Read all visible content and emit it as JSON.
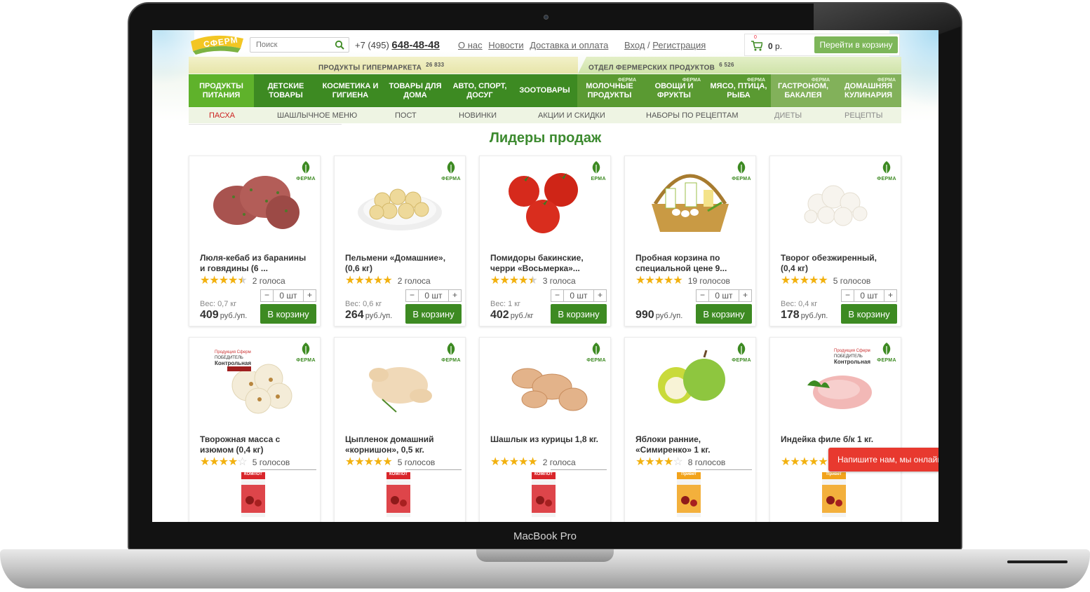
{
  "device": {
    "label": "MacBook Pro"
  },
  "header": {
    "logo_text": "СФЕРМ",
    "search_placeholder": "Поиск",
    "phone_prefix": "+7 (495)",
    "phone_number": "648-48-48",
    "links": [
      "О нас",
      "Новости",
      "Доставка и оплата"
    ],
    "login": "Вход",
    "register": "Регистрация",
    "cart_count": "0",
    "cart_sum": "0",
    "cart_currency": "р.",
    "cart_button": "Перейти в корзину"
  },
  "catalogs": {
    "left_title": "ПРОДУКТЫ ГИПЕРМАРКЕТА",
    "left_count": "26 833",
    "right_title": "ОТДЕЛ ФЕРМЕРСКИХ ПРОДУКТОВ",
    "right_count": "6 526"
  },
  "nav": [
    {
      "label": "Продукты питания",
      "farm": ""
    },
    {
      "label": "Детские товары",
      "farm": ""
    },
    {
      "label": "Косметика и гигиена",
      "farm": ""
    },
    {
      "label": "Товары для дома",
      "farm": ""
    },
    {
      "label": "Авто, спорт, досуг",
      "farm": ""
    },
    {
      "label": "Зоотовары",
      "farm": ""
    },
    {
      "label": "Молочные продукты",
      "farm": "ФЕРМА"
    },
    {
      "label": "Овощи и фрукты",
      "farm": "ФЕРМА"
    },
    {
      "label": "Мясо, птица, рыба",
      "farm": "ФЕРМА"
    },
    {
      "label": "Гастроном, бакалея",
      "farm": "ФЕРМА"
    },
    {
      "label": "Домашняя кулинария",
      "farm": "ФЕРМА"
    }
  ],
  "subnav": [
    "ПАСХА",
    "ШАШЛЫЧНОЕ МЕНЮ",
    "ПОСТ",
    "НОВИНКИ",
    "АКЦИИ И СКИДКИ",
    "НАБОРЫ ПО РЕЦЕПТАМ",
    "ДИЕТЫ",
    "РЕЦЕПТЫ"
  ],
  "section_title": "Лидеры продаж",
  "farm_badge": "ФЕРМА",
  "products_row1": [
    {
      "name": "Люля-кебаб из баранины и говядины (6 ...",
      "stars": "★★★★★",
      "votes": "2 голоса",
      "qty": "0 шт",
      "weight": "Вес: 0,7 кг",
      "price": "409",
      "unit": "руб./уп.",
      "buy": "В корзину"
    },
    {
      "name": "Пельмени «Домашние», (0,6 кг)",
      "stars": "★★★★★",
      "votes": "2 голоса",
      "qty": "0 шт",
      "weight": "Вес: 0,6 кг",
      "price": "264",
      "unit": "руб./уп.",
      "buy": "В корзину"
    },
    {
      "name": "Помидоры бакинские, черри «Восьмерка»...",
      "stars": "★★★★★",
      "votes": "3 голоса",
      "qty": "0 шт",
      "weight": "Вес: 1 кг",
      "price": "402",
      "unit": "руб./кг",
      "buy": "В корзину"
    },
    {
      "name": "Пробная корзина по специальной цене 9...",
      "stars": "★★★★★",
      "votes": "19 голосов",
      "qty": "0 шт",
      "weight": "",
      "price": "990",
      "unit": "руб./уп.",
      "buy": "В корзину"
    },
    {
      "name": "Творог обезжиренный, (0,4 кг)",
      "stars": "★★★★★",
      "votes": "5 голосов",
      "qty": "0 шт",
      "weight": "Вес: 0,4 кг",
      "price": "178",
      "unit": "руб./уп.",
      "buy": "В корзину"
    }
  ],
  "products_row2": [
    {
      "name": "Творожная масса с изюмом (0,4 кг)",
      "stars": "★★★★★",
      "votes": "5 голосов",
      "promo": "Продукция Сферм ПОБЕДИТЕЛЬ Контрольная закупка"
    },
    {
      "name": "Цыпленок домашний «корнишон», 0,5 кг.",
      "stars": "★★★★★",
      "votes": "5 голосов",
      "promo": ""
    },
    {
      "name": "Шашлык из курицы 1,8 кг.",
      "stars": "★★★★★",
      "votes": "2 голоса",
      "promo": ""
    },
    {
      "name": "Яблоки ранние, «Симиренко» 1 кг.",
      "stars": "★★★★★",
      "votes": "8 голосов",
      "promo": ""
    },
    {
      "name": "Индейка филе б/к 1 кг.",
      "stars": "★★★★★",
      "votes": "",
      "promo": "Продукция Сферм ПОБЕДИТЕЛЬ Контрольная закупка"
    }
  ],
  "ratings_row1": [
    4.5,
    5,
    4.5,
    5,
    5
  ],
  "ratings_row2": [
    4,
    5,
    5,
    4,
    5
  ],
  "juice_labels": [
    "КОМПОТ",
    "КОМПОТ",
    "КОМПОТ",
    "Привет",
    "Привет"
  ],
  "chat": "Напишите нам, мы онлайн"
}
